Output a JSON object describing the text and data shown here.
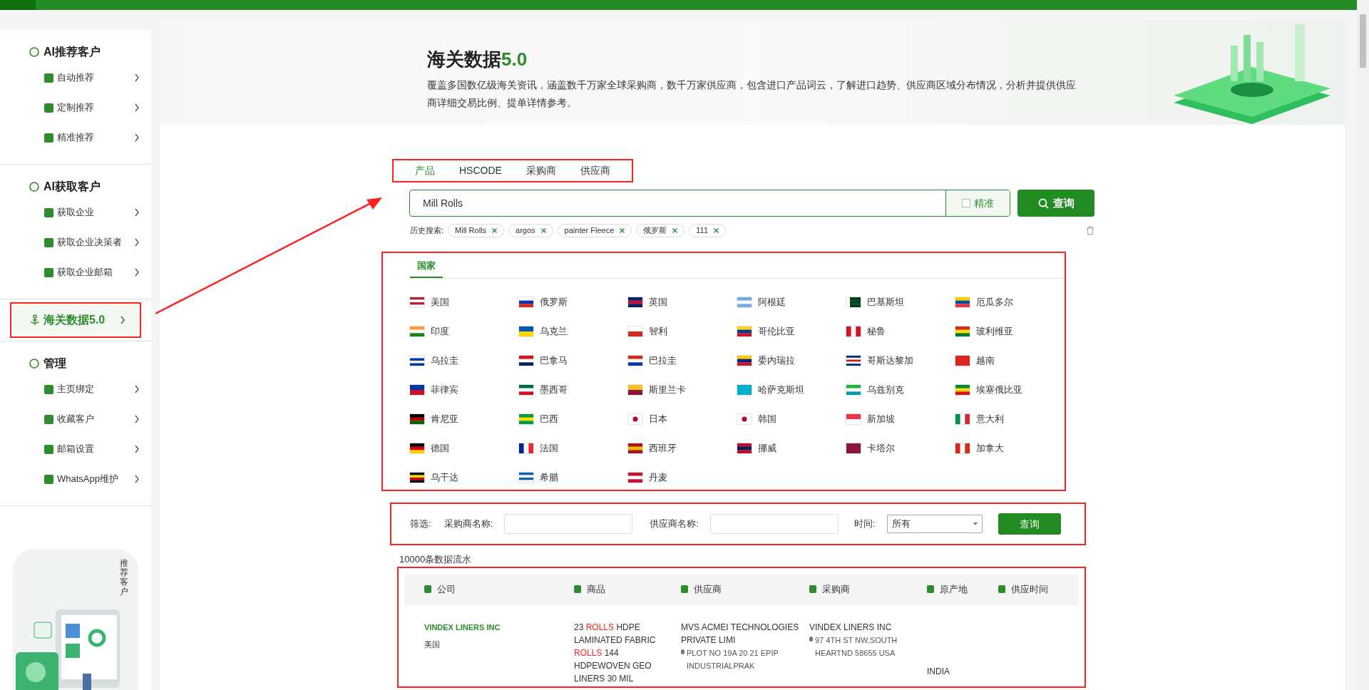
{
  "sidebar": {
    "groups": [
      {
        "kind": "section",
        "title": "AI推荐客户",
        "items": [
          {
            "label": "自动推荐",
            "selected": false
          },
          {
            "label": "定制推荐",
            "selected": false
          },
          {
            "label": "精准推荐",
            "selected": false
          }
        ]
      },
      {
        "kind": "section",
        "title": "AI获取客户",
        "items": [
          {
            "label": "获取企业",
            "selected": false
          },
          {
            "label": "获取企业决策者",
            "selected": false
          },
          {
            "label": "获取企业邮箱",
            "selected": false
          }
        ]
      },
      {
        "kind": "link",
        "title": "海关数据5.0",
        "selected": true
      },
      {
        "kind": "section",
        "title": "管理",
        "items": [
          {
            "label": "主页绑定",
            "selected": false
          },
          {
            "label": "收藏客户",
            "selected": false
          },
          {
            "label": "邮箱设置",
            "selected": false
          },
          {
            "label": "WhatsApp维护",
            "selected": false
          }
        ]
      }
    ],
    "promo": {
      "caption": "推荐客户"
    }
  },
  "header": {
    "title": "海关数据",
    "version": "5.0",
    "description": "覆盖多国数亿级海关资讯，涵盖数千万家全球采购商，数千万家供应商，包含进口产品词云，了解进口趋势、供应商区域分布情况，分析并提供供应商详细交易比例、提单详情参考。"
  },
  "search_tabs": [
    {
      "label": "产品",
      "selected": true
    },
    {
      "label": "HSCODE",
      "selected": false
    },
    {
      "label": "采购商",
      "selected": false
    },
    {
      "label": "供应商",
      "selected": false
    }
  ],
  "search": {
    "value": "Mill Rolls",
    "exact_label": "精准",
    "exact_checked": false,
    "button": "查询"
  },
  "history": {
    "label": "历史搜索:",
    "items": [
      "Mill Rolls",
      "argos",
      "painter Fleece",
      "俄罗斯",
      "111"
    ]
  },
  "country_tab": "国家",
  "countries": [
    "美国",
    "俄罗斯",
    "英国",
    "阿根廷",
    "巴基斯坦",
    "厄瓜多尔",
    "印度",
    "乌克兰",
    "智利",
    "哥伦比亚",
    "秘鲁",
    "玻利维亚",
    "乌拉圭",
    "巴拿马",
    "巴拉圭",
    "委内瑞拉",
    "哥斯达黎加",
    "越南",
    "菲律宾",
    "墨西哥",
    "斯里兰卡",
    "哈萨克斯坦",
    "乌兹别克",
    "埃塞俄比亚",
    "肯尼亚",
    "巴西",
    "日本",
    "韩国",
    "新加坡",
    "意大利",
    "德国",
    "法国",
    "西班牙",
    "挪威",
    "卡塔尔",
    "加拿大",
    "乌干达",
    "希腊",
    "丹麦"
  ],
  "filter": {
    "label": "筛选:",
    "buyer_label": "采购商名称:",
    "supplier_label": "供应商名称:",
    "time_label": "时间:",
    "time_value": "所有",
    "button": "查询"
  },
  "record_count": "10000条数据流水",
  "table": {
    "columns": [
      "公司",
      "商品",
      "供应商",
      "采购商",
      "原产地",
      "供应时间"
    ],
    "rows": [
      {
        "company": "VINDEX LINERS INC",
        "country": "美国",
        "product": [
          {
            "text": "23 ",
            "highlight": false
          },
          {
            "text": "ROLLS",
            "highlight": true
          },
          {
            "text": " HDPE LAMINATED FABRIC ",
            "highlight": false
          },
          {
            "text": "ROLLS",
            "highlight": true
          },
          {
            "text": " 144 HDPEWOVEN GEO LINERS 30 MIL",
            "highlight": false
          }
        ],
        "supplier": "MVS ACMEI TECHNOLOGIES PRIVATE LIMI",
        "supplier_address": "PLOT NO 19A 20 21 EPIP INDUSTRIALPRAK",
        "buyer": "VINDEX LINERS INC",
        "buyer_address": "97 4TH ST NW,SOUTH HEARTND 58655 USA",
        "origin": "INDIA"
      }
    ]
  }
}
